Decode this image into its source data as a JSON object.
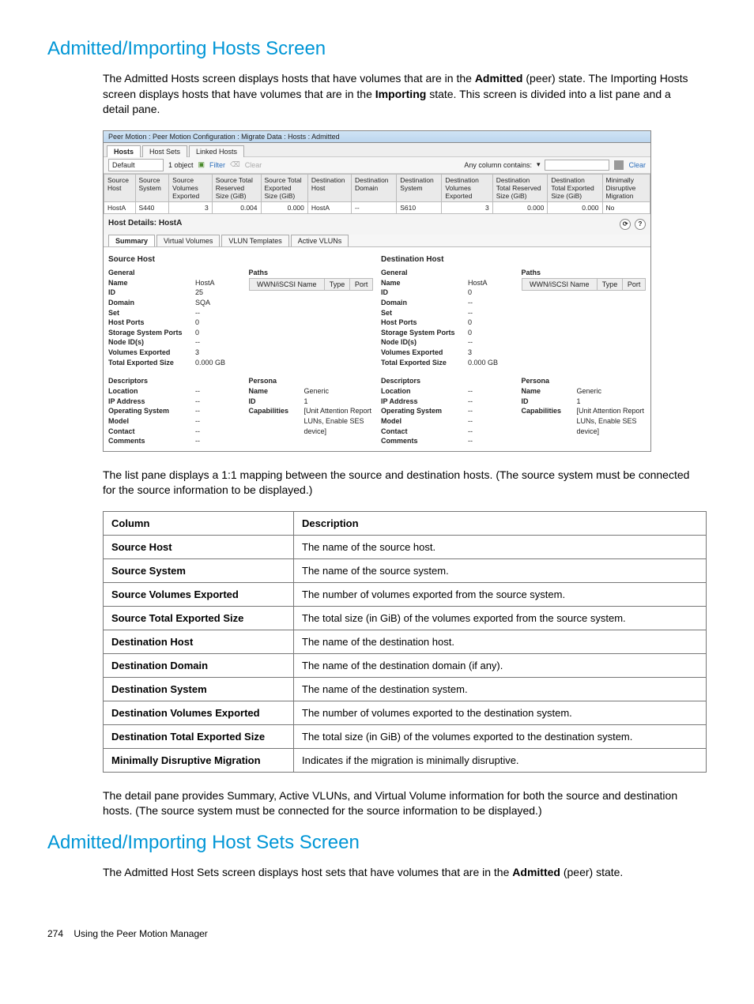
{
  "heading1": "Admitted/Importing Hosts Screen",
  "para1_a": "The Admitted Hosts screen displays hosts that have volumes that are in the ",
  "para1_b": "Admitted",
  "para1_c": " (peer) state. The Importing Hosts screen displays hosts that have volumes that are in the ",
  "para1_d": "Importing",
  "para1_e": " state. This screen is divided into a list pane and a detail pane.",
  "app": {
    "titlebar": "Peer Motion : Peer Motion Configuration : Migrate Data : Hosts : Admitted",
    "tabs_top": [
      "Hosts",
      "Host Sets",
      "Linked Hosts"
    ],
    "toolbar": {
      "default": "Default",
      "objects": "1 object",
      "filter": "Filter",
      "clear_top": "Clear",
      "any_column": "Any column contains:",
      "clear_right": "Clear"
    },
    "grid": {
      "cols": [
        "Source Host",
        "Source System",
        "Source Volumes Exported",
        "Source Total Reserved Size (GiB)",
        "Source Total Exported Size (GiB)",
        "Destination Host",
        "Destination Domain",
        "Destination System",
        "Destination Volumes Exported",
        "Destination Total Reserved Size (GiB)",
        "Destination Total Exported Size (GiB)",
        "Minimally Disruptive Migration"
      ],
      "row": [
        "HostA",
        "S440",
        "3",
        "0.004",
        "0.000",
        "HostA",
        "--",
        "S610",
        "3",
        "0.000",
        "0.000",
        "No"
      ]
    },
    "host_details_label": "Host Details: HostA",
    "tabs_detail": [
      "Summary",
      "Virtual Volumes",
      "VLUN Templates",
      "Active VLUNs"
    ],
    "src": {
      "title": "Source Host",
      "general": "General",
      "paths": "Paths",
      "path_cols": [
        "WWN/iSCSI Name",
        "Type",
        "Port"
      ],
      "kv": {
        "Name": "HostA",
        "ID": "25",
        "Domain": "SQA",
        "Set": "--",
        "Host Ports": "0",
        "Storage System Ports": "0",
        "Node ID(s)": "--",
        "Volumes Exported": "3",
        "Total Exported Size": "0.000 GB"
      },
      "descriptors": "Descriptors",
      "persona": "Persona",
      "desc_kv": {
        "Location": "--",
        "IP Address": "--",
        "Operating System": "--",
        "Model": "--",
        "Contact": "--",
        "Comments": "--"
      },
      "pers_kv": {
        "Name": "Generic",
        "ID": "1",
        "Capabilities": "[Unit Attention Report LUNs, Enable SES device]"
      }
    },
    "dst": {
      "title": "Destination Host",
      "general": "General",
      "paths": "Paths",
      "path_cols": [
        "WWN/iSCSI Name",
        "Type",
        "Port"
      ],
      "kv": {
        "Name": "HostA",
        "ID": "0",
        "Domain": "--",
        "Set": "--",
        "Host Ports": "0",
        "Storage System Ports": "0",
        "Node ID(s)": "--",
        "Volumes Exported": "3",
        "Total Exported Size": "0.000 GB"
      },
      "descriptors": "Descriptors",
      "persona": "Persona",
      "desc_kv": {
        "Location": "--",
        "IP Address": "--",
        "Operating System": "--",
        "Model": "--",
        "Contact": "--",
        "Comments": "--"
      },
      "pers_kv": {
        "Name": "Generic",
        "ID": "1",
        "Capabilities": "[Unit Attention Report LUNs, Enable SES device]"
      }
    }
  },
  "para2": "The list pane displays a 1:1 mapping between the source and destination hosts. (The source system must be connected for the source information to be displayed.)",
  "def_table": {
    "head": [
      "Column",
      "Description"
    ],
    "rows": [
      [
        "Source Host",
        "The name of the source host."
      ],
      [
        "Source System",
        "The name of the source system."
      ],
      [
        "Source Volumes Exported",
        "The number of volumes exported from the source system."
      ],
      [
        "Source Total Exported Size",
        "The total size (in GiB) of the volumes exported from the source system."
      ],
      [
        "Destination Host",
        "The name of the destination host."
      ],
      [
        "Destination Domain",
        "The name of the destination domain (if any)."
      ],
      [
        "Destination System",
        "The name of the destination system."
      ],
      [
        "Destination Volumes Exported",
        "The number of volumes exported to the destination system."
      ],
      [
        "Destination Total Exported Size",
        "The total size (in GiB) of the volumes exported to the destination system."
      ],
      [
        "Minimally Disruptive Migration",
        "Indicates if the migration is minimally disruptive."
      ]
    ]
  },
  "para3": "The detail pane provides Summary, Active VLUNs, and Virtual Volume information for both the source and destination hosts. (The source system must be connected for the source information to be displayed.)",
  "heading2": "Admitted/Importing Host Sets Screen",
  "para4_a": "The Admitted Host Sets screen displays host sets that have volumes that are in the ",
  "para4_b": "Admitted",
  "para4_c": " (peer) state.",
  "footer": {
    "page": "274",
    "label": "Using the Peer Motion Manager"
  }
}
